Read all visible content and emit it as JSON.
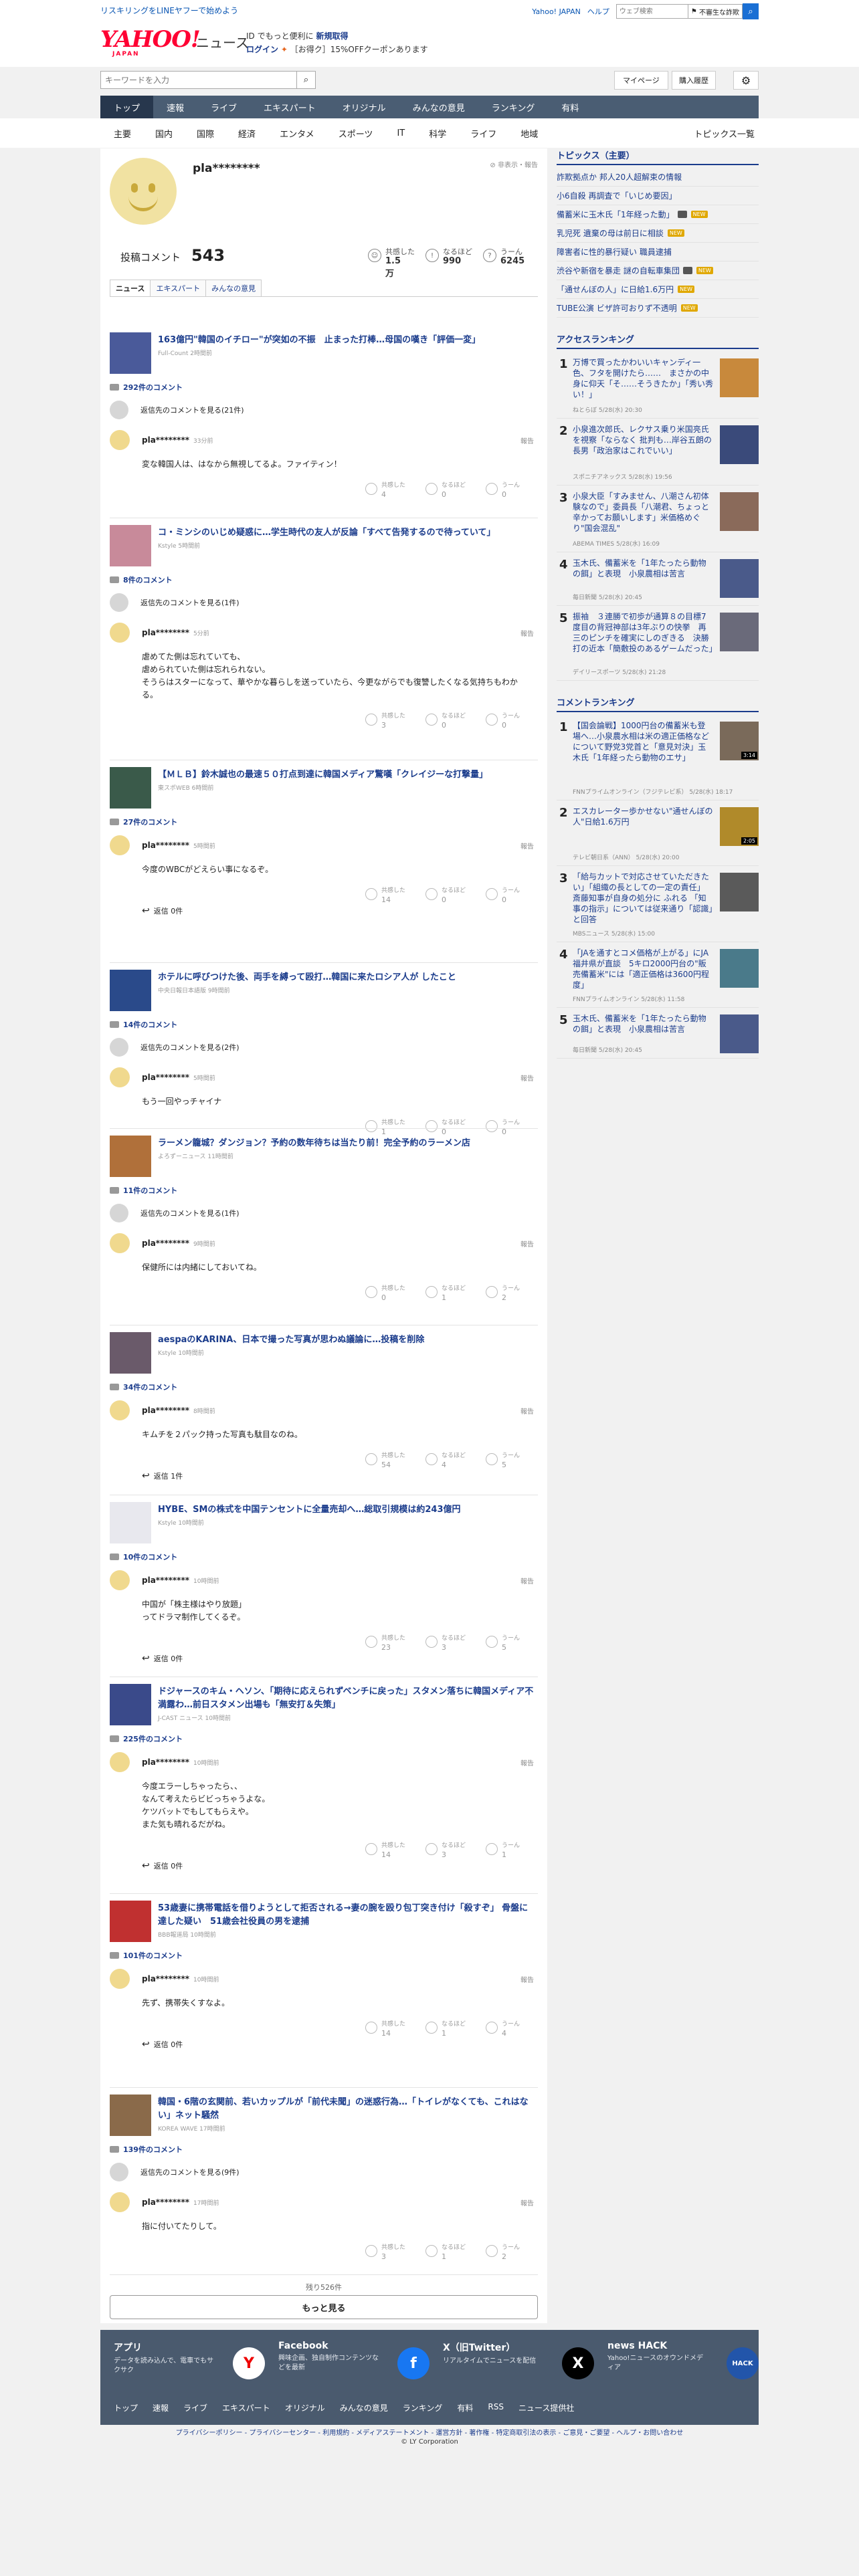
{
  "header": {
    "promo_link": "リスキリングをLINEヤフーで始めよう",
    "top_links": [
      "Yahoo! JAPAN",
      "ヘルプ"
    ],
    "web_search_placeholder": "ウェブ検索",
    "weather_label": "不審生な詐欺",
    "logo": "YAHOO!",
    "logo_sub": "JAPAN",
    "logo_news": "ニュース",
    "promo_line1_a": "ID でもっと便利に",
    "promo_line1_b": "新規取得",
    "promo_line2_a": "ログイン",
    "promo_line2_b": "［お得ク］15%OFFクーポンあります"
  },
  "search": {
    "placeholder": "キーワードを入力",
    "mypage": "マイページ",
    "history": "購入履歴"
  },
  "gnav": [
    "トップ",
    "速報",
    "ライブ",
    "エキスパート",
    "オリジナル",
    "みんなの意見",
    "ランキング",
    "有料"
  ],
  "subnav": [
    "主要",
    "国内",
    "国際",
    "経済",
    "エンタメ",
    "スポーツ",
    "IT",
    "科学",
    "ライフ",
    "地域"
  ],
  "topics_list_link": "トピックス一覧",
  "profile": {
    "username": "pla********",
    "hide_report": "非表示・報告",
    "comment_count_label": "投稿コメント",
    "comment_count": "543",
    "stats": [
      {
        "label": "共感した",
        "value": "1.5万"
      },
      {
        "label": "なるほど",
        "value": "990"
      },
      {
        "label": "うーん",
        "value": "6245"
      }
    ],
    "tabs": [
      "ニュース",
      "エキスパート",
      "みんなの意見"
    ]
  },
  "entries": [
    {
      "title": "163億円\"韓国のイチロー\"が突如の不振　止まった打棒…母国の嘆き「評価一変」",
      "source": "Full-Count 2時間前",
      "comment_count": "292件のコメント",
      "more": "返信先のコメントを見る(21件)",
      "user": "pla********",
      "time": "33分前",
      "report": "報告",
      "body": "変な韓国人は、はなから無視してるよ。ファイティン！",
      "reactions": [
        {
          "label": "共感した",
          "n": "4"
        },
        {
          "label": "なるほど",
          "n": "0"
        },
        {
          "label": "うーん",
          "n": "0"
        }
      ],
      "reply": ""
    },
    {
      "title": "コ・ミンシのいじめ疑惑に…学生時代の友人が反論「すべて告発するので待っていて」",
      "source": "Kstyle 5時間前",
      "comment_count": "8件のコメント",
      "more": "返信先のコメントを見る(1件)",
      "user": "pla********",
      "time": "5分前",
      "report": "報告",
      "body": "虐めてた側は忘れていても、\n虐められていた側は忘れられない。\nそうらはスターになって、華やかな暮らしを送っていたら、今更ながらでも復讐したくなる気持ちもわかる。",
      "reactions": [
        {
          "label": "共感した",
          "n": "3"
        },
        {
          "label": "なるほど",
          "n": "0"
        },
        {
          "label": "うーん",
          "n": "0"
        }
      ],
      "reply": ""
    },
    {
      "title": "【ＭＬＢ】鈴木誠也の最速５０打点到達に韓国メディア驚嘆「クレイジーな打撃量」",
      "source": "東スポWEB 6時間前",
      "comment_count": "27件のコメント",
      "more": "",
      "user": "pla********",
      "time": "5時間前",
      "report": "報告",
      "body": "今度のWBCがどえらい事になるぞ。",
      "reactions": [
        {
          "label": "共感した",
          "n": "14"
        },
        {
          "label": "なるほど",
          "n": "0"
        },
        {
          "label": "うーん",
          "n": "0"
        }
      ],
      "reply": "返信 0件"
    },
    {
      "title": "ホテルに呼びつけた後、両手を縛って殴打…韓国に来たロシア人が したこと",
      "source": "中央日報日本語版 9時間前",
      "comment_count": "14件のコメント",
      "more": "返信先のコメントを見る(2件)",
      "user": "pla********",
      "time": "5時間前",
      "report": "報告",
      "body": "もう一回やっチャイナ",
      "reactions": [
        {
          "label": "共感した",
          "n": "1"
        },
        {
          "label": "なるほど",
          "n": "0"
        },
        {
          "label": "うーん",
          "n": "0"
        }
      ],
      "reply": ""
    },
    {
      "title": "ラーメン籠城？ダンジョン？予約の数年待ちは当たり前！完全予約のラーメン店",
      "source": "よろずーニュース 11時間前",
      "comment_count": "11件のコメント",
      "more": "返信先のコメントを見る(1件)",
      "user": "pla********",
      "time": "9時間前",
      "report": "報告",
      "body": "保健所には内緒にしておいてね。",
      "reactions": [
        {
          "label": "共感した",
          "n": "0"
        },
        {
          "label": "なるほど",
          "n": "1"
        },
        {
          "label": "うーん",
          "n": "2"
        }
      ],
      "reply": ""
    },
    {
      "title": "aespaのKARINA、日本で撮った写真が思わぬ議論に…投稿を削除",
      "source": "Kstyle 10時間前",
      "comment_count": "34件のコメント",
      "more": "",
      "user": "pla********",
      "time": "8時間前",
      "report": "報告",
      "body": "キムチを２パック持った写真も駄目なのね。",
      "reactions": [
        {
          "label": "共感した",
          "n": "54"
        },
        {
          "label": "なるほど",
          "n": "4"
        },
        {
          "label": "うーん",
          "n": "5"
        }
      ],
      "reply": "返信 1件"
    },
    {
      "title": "HYBE、SMの株式を中国テンセントに全量売却へ…総取引規模は約243億円",
      "source": "Kstyle 10時間前",
      "comment_count": "10件のコメント",
      "more": "",
      "user": "pla********",
      "time": "10時間前",
      "report": "報告",
      "body": "中国が「株主様はやり放題」\nってドラマ制作してくるぞ。",
      "reactions": [
        {
          "label": "共感した",
          "n": "23"
        },
        {
          "label": "なるほど",
          "n": "3"
        },
        {
          "label": "うーん",
          "n": "5"
        }
      ],
      "reply": "返信 0件"
    },
    {
      "title": "ドジャースのキム・ヘソン、「期待に応えられずベンチに戻った」スタメン落ちに韓国メディア不満露わ…前日スタメン出場も「無安打＆失策」",
      "source": "J-CAST ニュース 10時間前",
      "comment_count": "225件のコメント",
      "more": "",
      "user": "pla********",
      "time": "10時間前",
      "report": "報告",
      "body": "今度エラーしちゃったら、、\nなんて考えたらビビっちゃうよな。\nケツバットでもしてもらえや。\nまた気も晴れるだがね。",
      "reactions": [
        {
          "label": "共感した",
          "n": "14"
        },
        {
          "label": "なるほど",
          "n": "3"
        },
        {
          "label": "うーん",
          "n": "1"
        }
      ],
      "reply": "返信 0件"
    },
    {
      "title": "53歳妻に携帯電話を借りようとして拒否される→妻の腕を殴り包丁突き付け「殺すぞ」 骨盤に達した疑い　51歳会社役員の男を逮捕",
      "source": "BBB報道局 10時間前",
      "comment_count": "101件のコメント",
      "more": "",
      "user": "pla********",
      "time": "10時間前",
      "report": "報告",
      "body": "先ず、携帯失くすなよ。",
      "reactions": [
        {
          "label": "共感した",
          "n": "14"
        },
        {
          "label": "なるほど",
          "n": "1"
        },
        {
          "label": "うーん",
          "n": "4"
        }
      ],
      "reply": "返信 0件"
    },
    {
      "title": "韓国・6階の玄関前、若いカップルが「前代未聞」の迷惑行為…「トイレがなくても、これはない」ネット騒然",
      "source": "KOREA WAVE 17時間前",
      "comment_count": "139件のコメント",
      "more": "返信先のコメントを見る(9件)",
      "user": "pla********",
      "time": "17時間前",
      "report": "報告",
      "body": "指に付いてたりして。",
      "reactions": [
        {
          "label": "共感した",
          "n": "3"
        },
        {
          "label": "なるほど",
          "n": "1"
        },
        {
          "label": "うーん",
          "n": "2"
        }
      ],
      "reply": ""
    }
  ],
  "remaining": "残り526件",
  "more_button": "もっと見る",
  "sidebar": {
    "topics_heading": "トピックス（主要）",
    "topics": [
      {
        "text": "詐欺拠点か 邦人20人超解束の情報",
        "tag": "",
        "video": false
      },
      {
        "text": "小6自殺 再調査で「いじめ要因」",
        "tag": "",
        "video": false
      },
      {
        "text": "備蓄米に玉木氏「1年経った動」",
        "tag": "NEW",
        "video": true
      },
      {
        "text": "乳児死 遺棄の母は前日に相談",
        "tag": "NEW",
        "video": false
      },
      {
        "text": "障害者に性的暴行疑い 職員逮捕",
        "tag": "",
        "video": false
      },
      {
        "text": "渋谷や新宿を暴走 謎の自転車集団",
        "tag": "NEW",
        "video": true
      },
      {
        "text": "「通せんぼの人」に日給1.6万円",
        "tag": "NEW",
        "video": false
      },
      {
        "text": "TUBE公演 ビザ許可おりず不透明",
        "tag": "NEW",
        "video": false
      }
    ],
    "access_heading": "アクセスランキング",
    "access": [
      {
        "rank": "1",
        "title": "万博で買ったかわいいキャンディ一色、フタを開けたら……　まさかの中身に仰天「そ……そうきたか」「秀い秀い！」",
        "source": "ねとらぼ 5/28(水) 20:30",
        "duration": "",
        "color": "#c8893c"
      },
      {
        "rank": "2",
        "title": "小泉進次郎氏、レクサス乗り米国亮氏を視察「ならなく 批判も…岸谷五朗の長男「政治家はこれでいい」",
        "source": "スポニチアネックス 5/28(水) 19:56",
        "duration": "",
        "color": "#3a4a7a"
      },
      {
        "rank": "3",
        "title": "小泉大臣「すみません、八潮さん初体験なので」委員長「八潮君、ちょっと辛かってお願いします」米価格めぐり\"国会混乱\"",
        "source": "ABEMA TIMES 5/28(水) 16:09",
        "duration": "",
        "color": "#8a6a5a"
      },
      {
        "rank": "4",
        "title": "玉木氏、備蓄米を「1年たったら動物の餌」と表現　小泉農相は苦言",
        "source": "毎日新聞 5/28(水) 20:45",
        "duration": "",
        "color": "#4a5a8a"
      },
      {
        "rank": "5",
        "title": "振袖　３連勝で初歩が通算８の目標7度目の背冠神部は3年ぶりの快挙　再三のピンチを確実にしのぎきる　決勝打の近本「簡敷投のあるゲームだった」",
        "source": "デイリースポーツ 5/28(水) 21:28",
        "duration": "",
        "color": "#6a6a7a"
      }
    ],
    "comment_heading": "コメントランキング",
    "comment": [
      {
        "rank": "1",
        "title": "【国会論戦】1000円台の備蓄米も登場へ…小泉農水相は米の適正価格などについて野党3党首と「意見対決」玉木氏「1年経ったら動物のエサ」",
        "source": "FNNプライムオンライン（フジテレビ系） 5/28(水) 18:17",
        "duration": "3:14",
        "color": "#7a6a5a"
      },
      {
        "rank": "2",
        "title": "エスカレーター歩かせない\"通せんぼの人\"日給1.6万円",
        "source": "テレビ朝日系（ANN） 5/28(水) 20:00",
        "duration": "2:05",
        "color": "#b08a2a"
      },
      {
        "rank": "3",
        "title": "「給与カットで対応させていただきたい」「組織の長としての一定の責任」 斎藤知事が自身の処分に ふれる 「知事の指示」については従来通り「認識」と回答",
        "source": "MBSニュース 5/28(水) 15:00",
        "duration": "",
        "color": "#5a5a5a"
      },
      {
        "rank": "4",
        "title": "「JAを通すとコメ価格が上がる」にJA福井県が直談　5キロ2000円台の\"販売備蓄米\"には「適正価格は3600円程度」",
        "source": "FNNプライムオンライン 5/28(水) 11:58",
        "duration": "",
        "color": "#4a7a8a"
      },
      {
        "rank": "5",
        "title": "玉木氏、備蓄米を「1年たったら動物の餌」と表現　小泉農相は苦言",
        "source": "毎日新聞 5/28(水) 20:45",
        "duration": "",
        "color": "#4a5a8a"
      }
    ]
  },
  "footer": {
    "cards": [
      {
        "title": "アプリ",
        "desc": "データを読み込んで、電車でもサクサク",
        "icon": "Y",
        "color": "#ffffff"
      },
      {
        "title": "Facebook",
        "desc": "興味企画、独自制作コンテンツなどを最新",
        "icon": "f",
        "color": "#1877f2"
      },
      {
        "title": "X（旧Twitter）",
        "desc": "リアルタイムでニュースを配信",
        "icon": "X",
        "color": "#000000"
      },
      {
        "title": "news HACK",
        "desc": "Yahoo!ニュースのオウンドメディア",
        "icon": "HACK",
        "color": "#2255aa"
      }
    ],
    "nav": [
      "トップ",
      "速報",
      "ライブ",
      "エキスパート",
      "オリジナル",
      "みんなの意見",
      "ランキング",
      "有料",
      "RSS",
      "ニュース提供社"
    ],
    "legal": "プライバシーポリシー - プライバシーセンター - 利用規約 - メディアステートメント - 運営方針 - 著作権 - 特定商取引法の表示 - ご意見・ご要望 - ヘルプ・お問い合わせ",
    "copyright": "© LY Corporation"
  },
  "colors": {
    "accent": "#1b3c8c",
    "nav": "#4a5d73",
    "logo": "#ff0033"
  },
  "icons": [
    "search-icon",
    "gear-icon",
    "hide-icon",
    "comment-bubble-icon",
    "reply-arrow-icon",
    "reaction-circle-icon",
    "video-icon"
  ]
}
